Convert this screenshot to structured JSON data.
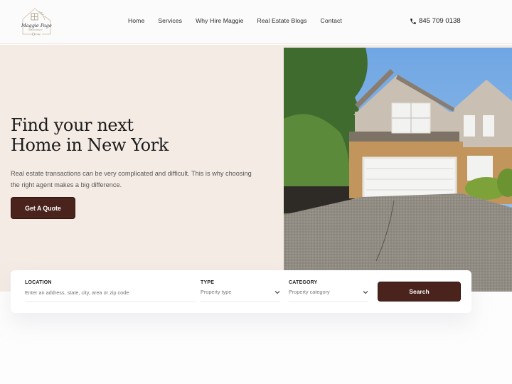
{
  "brand": {
    "logo_name": "Maggie Page",
    "logo_subtitle": "DREAM REALTY"
  },
  "nav": {
    "items": [
      {
        "label": "Home"
      },
      {
        "label": "Services"
      },
      {
        "label": "Why Hire Maggie"
      },
      {
        "label": "Real Estate Blogs"
      },
      {
        "label": "Contact"
      }
    ]
  },
  "contact": {
    "icon": "phone-icon",
    "phone": "845 709 0138"
  },
  "hero": {
    "title_line1": "Find your next",
    "title_line2": "Home in New York",
    "description": "Real estate transactions can be very complicated and difficult. This is why choosing the right agent makes a big difference.",
    "cta_label": "Get A Quote",
    "image_alt": "Two-story house with white garage door and driveway"
  },
  "search": {
    "location": {
      "label": "LOCATION",
      "placeholder": "Enter an address, state, city, area or zip code",
      "value": ""
    },
    "type": {
      "label": "TYPE",
      "selected": "Property type"
    },
    "category": {
      "label": "CATEGORY",
      "selected": "Property category"
    },
    "button_label": "Search"
  },
  "colors": {
    "accent": "#4a241c",
    "hero_bg": "#f5ebe5",
    "header_bg": "#fbfbfc"
  }
}
